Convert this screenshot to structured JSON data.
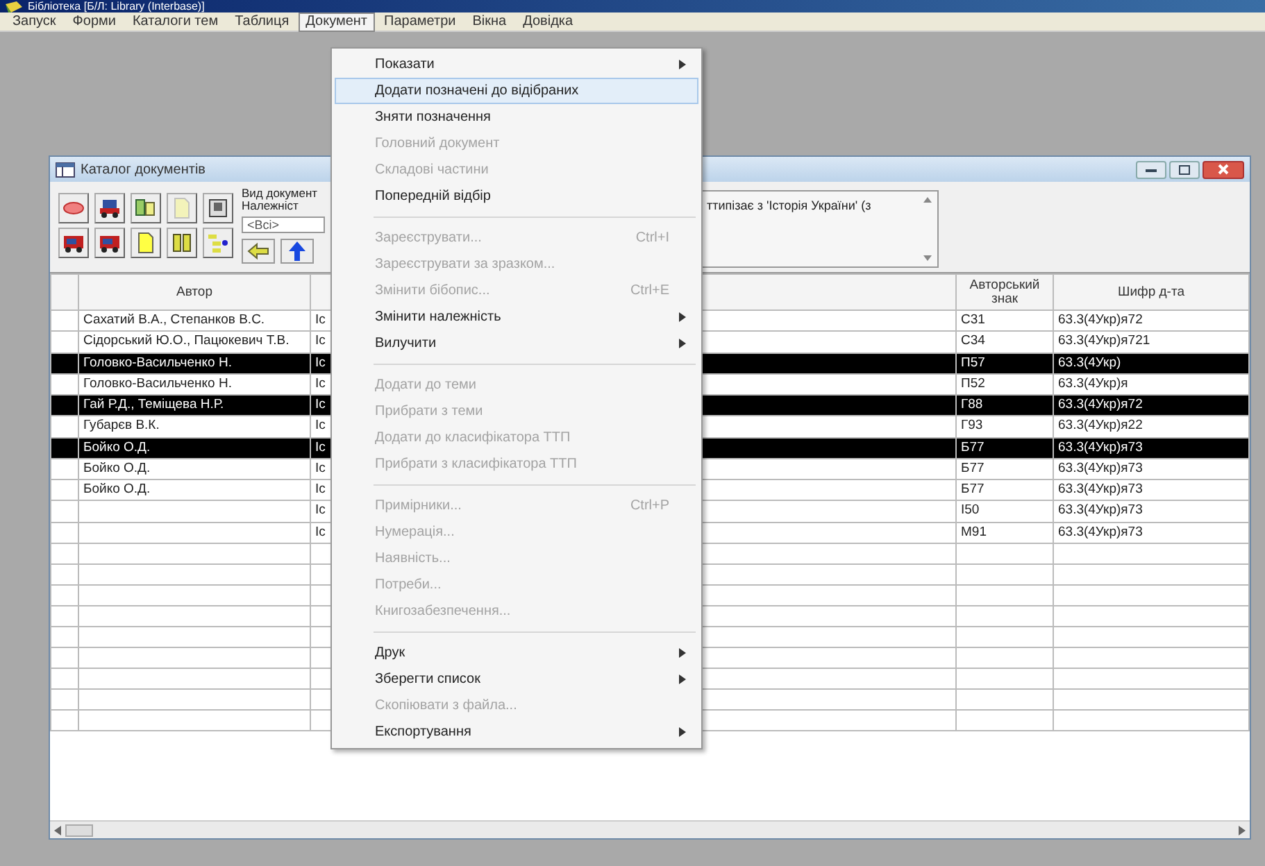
{
  "app": {
    "title": "Бібліотека [Б/Л: Library (Interbase)]"
  },
  "menubar": [
    {
      "label": "Запуск",
      "selected": false
    },
    {
      "label": "Форми",
      "selected": false
    },
    {
      "label": "Каталоги тем",
      "selected": false
    },
    {
      "label": "Таблиця",
      "selected": false
    },
    {
      "label": "Документ",
      "selected": true
    },
    {
      "label": "Параметри",
      "selected": false
    },
    {
      "label": "Вікна",
      "selected": false
    },
    {
      "label": "Довідка",
      "selected": false
    }
  ],
  "menu": {
    "groups": [
      [
        {
          "label": "Показати",
          "disabled": false,
          "submenu": true,
          "selected": false
        },
        {
          "label": "Додати позначені до відібраних",
          "disabled": false,
          "submenu": false,
          "selected": true
        },
        {
          "label": "Зняти позначення",
          "disabled": false,
          "submenu": false,
          "selected": false
        },
        {
          "label": "Головний документ",
          "disabled": true,
          "submenu": false,
          "selected": false
        },
        {
          "label": "Складові частини",
          "disabled": true,
          "submenu": false,
          "selected": false
        },
        {
          "label": "Попередній відбір",
          "disabled": false,
          "submenu": false,
          "selected": false
        }
      ],
      [
        {
          "label": "Зареєструвати...",
          "shortcut": "Ctrl+I",
          "disabled": true,
          "submenu": false,
          "selected": false
        },
        {
          "label": "Зареєструвати за зразком...",
          "disabled": true,
          "submenu": false,
          "selected": false
        },
        {
          "label": "Змінити бібопис...",
          "shortcut": "Ctrl+E",
          "disabled": true,
          "submenu": false,
          "selected": false
        },
        {
          "label": "Змінити належність",
          "disabled": false,
          "submenu": true,
          "selected": false
        },
        {
          "label": "Вилучити",
          "disabled": false,
          "submenu": true,
          "selected": false
        }
      ],
      [
        {
          "label": "Додати до теми",
          "disabled": true,
          "submenu": false,
          "selected": false
        },
        {
          "label": "Прибрати з теми",
          "disabled": true,
          "submenu": false,
          "selected": false
        },
        {
          "label": "Додати до класифікатора ТТП",
          "disabled": true,
          "submenu": false,
          "selected": false
        },
        {
          "label": "Прибрати з класифікатора ТТП",
          "disabled": true,
          "submenu": false,
          "selected": false
        }
      ],
      [
        {
          "label": "Примірники...",
          "shortcut": "Ctrl+P",
          "disabled": true,
          "submenu": false,
          "selected": false
        },
        {
          "label": "Нумерація...",
          "disabled": true,
          "submenu": false,
          "selected": false
        },
        {
          "label": "Наявність...",
          "disabled": true,
          "submenu": false,
          "selected": false
        },
        {
          "label": "Потреби...",
          "disabled": true,
          "submenu": false,
          "selected": false
        },
        {
          "label": "Книгозабезпечення...",
          "disabled": true,
          "submenu": false,
          "selected": false
        }
      ],
      [
        {
          "label": "Друк",
          "disabled": false,
          "submenu": true,
          "selected": false
        },
        {
          "label": "Зберегти список",
          "disabled": false,
          "submenu": true,
          "selected": false
        },
        {
          "label": "Скопіювати з файла...",
          "disabled": true,
          "submenu": false,
          "selected": false
        },
        {
          "label": "Експортування",
          "disabled": false,
          "submenu": true,
          "selected": false
        }
      ]
    ]
  },
  "window": {
    "title": "Каталог документів",
    "toolbar": [
      {
        "disabled": false
      },
      {
        "disabled": false
      },
      {
        "disabled": false
      },
      {
        "disabled": true
      },
      {
        "disabled": false
      },
      {
        "disabled": false
      },
      {
        "disabled": false
      },
      {
        "disabled": false
      },
      {
        "disabled": false
      },
      {
        "disabled": false
      }
    ],
    "filter": {
      "label_1": "Вид документ",
      "label_2": "Належніст",
      "value": "<Всі>"
    },
    "topic_text": "ттипізає з 'Історія України' (з",
    "columns": [
      "Автор",
      "",
      "Авторський знак",
      "Шифр д-та"
    ],
    "rows": [
      {
        "author": "Сахатий В.А., Степанков В.С.",
        "column_2": "Іс",
        "sign": "С31",
        "code": "63.3(4Укр)я72",
        "selected": false
      },
      {
        "author": "Сідорський Ю.О., Пацюкевич Т.В.",
        "column_2": "Іс",
        "sign": "С34",
        "code": "63.3(4Укр)я721",
        "selected": false
      },
      {
        "author": "Головко-Васильченко Н.",
        "column_2": "Іс",
        "sign": "П57",
        "code": "63.3(4Укр)",
        "selected": true
      },
      {
        "author": "Головко-Васильченко Н.",
        "column_2": "Іс",
        "sign": "П52",
        "code": "63.3(4Укр)я",
        "selected": false
      },
      {
        "author": "Гай Р.Д., Теміщева Н.Р.",
        "column_2": "Іс",
        "sign": "Г88",
        "code": "63.3(4Укр)я72",
        "selected": true
      },
      {
        "author": "Губарєв В.К.",
        "column_2": "Іс",
        "sign": "Г93",
        "code": "63.3(4Укр)я22",
        "selected": false
      },
      {
        "author": "Бойко О.Д.",
        "column_2": "Іс",
        "sign": "Б77",
        "code": "63.3(4Укр)я73",
        "selected": true
      },
      {
        "author": "Бойко О.Д.",
        "column_2": "Іс",
        "sign": "Б77",
        "code": "63.3(4Укр)я73",
        "selected": false
      },
      {
        "author": "Бойко О.Д.",
        "column_2": "Іс",
        "sign": "Б77",
        "code": "63.3(4Укр)я73",
        "selected": false
      },
      {
        "author": "",
        "column_2": "Іс",
        "sign": "І50",
        "code": "63.3(4Укр)я73",
        "selected": false
      },
      {
        "author": "",
        "column_2": "Іс",
        "sign": "М91",
        "code": "63.3(4Укр)я73",
        "selected": false
      }
    ]
  }
}
